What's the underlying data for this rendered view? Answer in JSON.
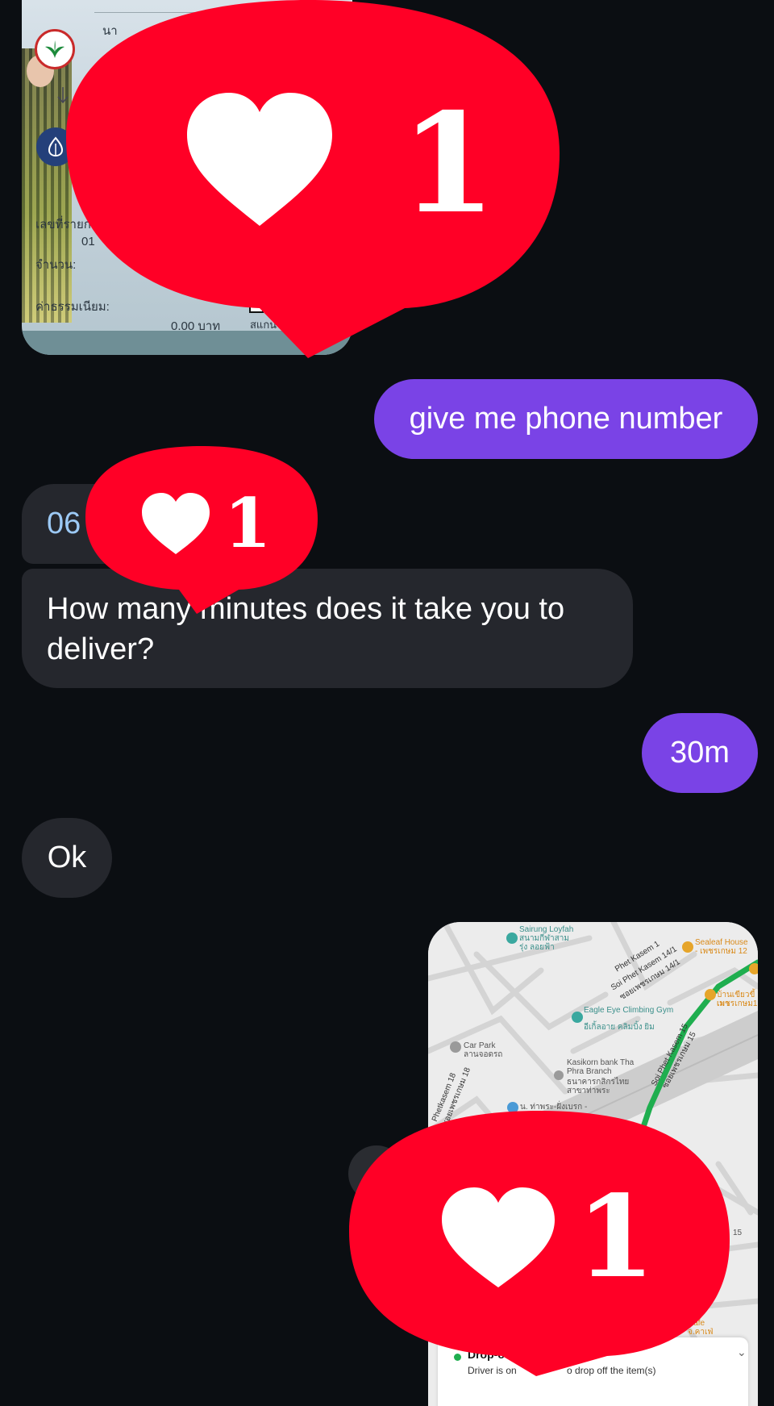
{
  "receipt": {
    "amount_label": "จำนวน:",
    "fee_label": "ค่าธรรมเนียม:",
    "fee_value": "0.00 บาท",
    "ref_label": "เลขที่รายก",
    "ref_value_partial": "01",
    "name_partial": "นา",
    "scan_partial": "สแกน"
  },
  "messages": {
    "give_phone": "give me phone number",
    "phone_partial": "06",
    "delivery_question": "How many minutes does it take you to deliver?",
    "reply_30m": "30m",
    "reply_ok": "Ok"
  },
  "map": {
    "poi_sairung": "Sairung Loyfah",
    "poi_sairung_th": "สนามกีฬาสามรุ่ง ลอยฟ้า",
    "road_phet_kasem_1": "Phet Kasem 1",
    "road_soi_phet_kasem_14": "Soi Phet Kasem 14/1",
    "road_soi_phet_kasem_14_th": "ซอยเพชรเกษม 14/1",
    "poi_sealeaf": "Sealeaf House",
    "poi_sealeaf_th": "- เพชรเกษม 12",
    "poi_restaurant_th": "บ้านเขียวขี้เมา",
    "poi_restaurant_th2": "เพชรเกษม1",
    "poi_eagle_eye": "Eagle Eye Climbing Gym",
    "poi_eagle_eye_th": "อีเกิ้ลอาย คลิมบิ้ง ยิม",
    "poi_car_park": "Car Park",
    "poi_car_park_th": "ลานจอดรถ",
    "poi_kasikorn": "Kasikorn bank Tha Phra Branch",
    "poi_kasikorn_th": "ธนาคารกสิกรไทย สาขาท่าพระ",
    "road_soi_phet_kasem_15": "Soi Phet Kasem 15",
    "road_soi_phet_kasem_15_th": "ซอยเพชรเกษม 15",
    "road_phetkasem_18": "Phetkasem 18",
    "road_phetkasem_18_th": "ซอยเพชรเกษม 18",
    "poi_tha_phra": "น. ท่าพระ-ฝั่งเบรก -",
    "poi_cafe": "Cafe",
    "poi_cafe_th": "จ.คาเฟ่",
    "map_number_15": "15",
    "drop_title_partial": "Drop-o",
    "drop_status_left": "Driver is on",
    "drop_status_right": "o drop off the item(s)"
  },
  "likes": {
    "top_count": "1",
    "middle_count": "1",
    "bottom_count": "1"
  },
  "colors": {
    "outgoing_bubble": "#7a43e6",
    "incoming_bubble": "#25272d",
    "like_red": "#ff0026",
    "background": "#0b0e12",
    "route_green": "#1fae4f"
  }
}
